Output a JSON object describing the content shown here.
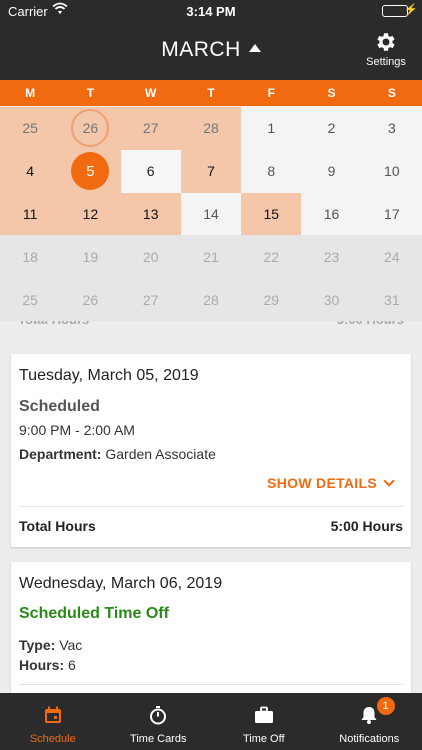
{
  "status_bar": {
    "carrier": "Carrier",
    "time": "3:14 PM"
  },
  "header": {
    "month": "MARCH",
    "settings_label": "Settings"
  },
  "weekdays": [
    "M",
    "T",
    "W",
    "T",
    "F",
    "S",
    "S"
  ],
  "calendar": [
    [
      "25",
      "26",
      "27",
      "28",
      "1",
      "2",
      "3"
    ],
    [
      "4",
      "5",
      "6",
      "7",
      "8",
      "9",
      "10"
    ],
    [
      "11",
      "12",
      "13",
      "14",
      "15",
      "16",
      "17"
    ],
    [
      "18",
      "19",
      "20",
      "21",
      "22",
      "23",
      "24"
    ],
    [
      "25",
      "26",
      "27",
      "28",
      "29",
      "30",
      "31"
    ]
  ],
  "cards": [
    {
      "date": "Tuesday, March 05, 2019",
      "status": "Scheduled",
      "time_range": "9:00 PM - 2:00 AM",
      "department_label": "Department:",
      "department_value": "Garden Associate",
      "show_details": "SHOW DETAILS",
      "total_label": "Total Hours",
      "total_value": "5:00 Hours"
    },
    {
      "date": "Wednesday, March 06, 2019",
      "status": "Scheduled Time Off",
      "type_label": "Type:",
      "type_value": "Vac",
      "hours_label": "Hours:",
      "hours_value": "6"
    }
  ],
  "tabs": [
    {
      "label": "Schedule",
      "icon": "calendar-icon"
    },
    {
      "label": "Time Cards",
      "icon": "stopwatch-icon"
    },
    {
      "label": "Time Off",
      "icon": "briefcase-icon"
    },
    {
      "label": "Notifications",
      "icon": "bell-icon",
      "badge": "1"
    }
  ],
  "colors": {
    "accent": "#f26a10",
    "header": "#2b2b2b",
    "scheduled_green": "#2a8a18"
  }
}
